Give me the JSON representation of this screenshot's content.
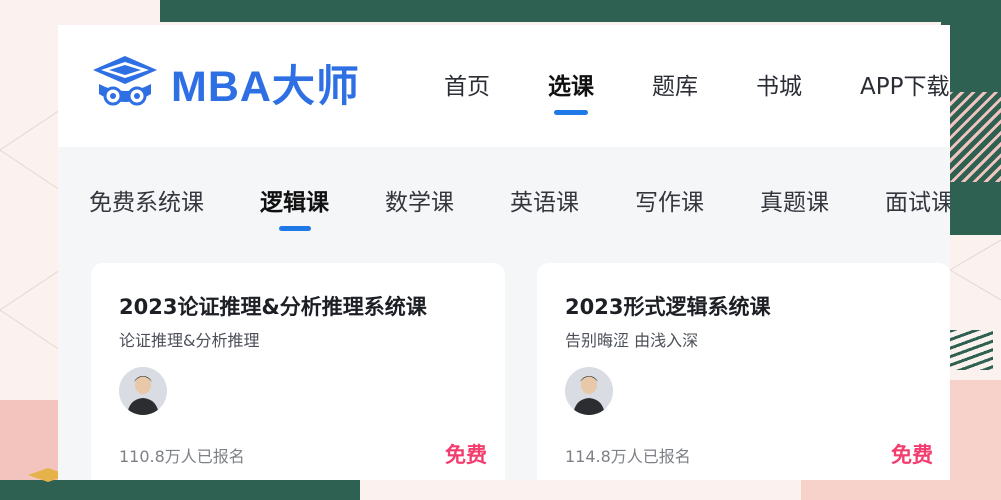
{
  "brand": {
    "name": "MBA大师",
    "accent": "#2f6fe4"
  },
  "nav": {
    "items": [
      "首页",
      "选课",
      "题库",
      "书城",
      "APP下载"
    ],
    "active_index": 1
  },
  "subnav": {
    "items": [
      "免费系统课",
      "逻辑课",
      "数学课",
      "英语课",
      "写作课",
      "真题课",
      "面试课"
    ],
    "active_index": 1
  },
  "courses": [
    {
      "title": "2023论证推理&分析推理系统课",
      "subtitle": "论证推理&分析推理",
      "enrolled": "110.8万人已报名",
      "price": "免费",
      "icon": "teacher-avatar"
    },
    {
      "title": "2023形式逻辑系统课",
      "subtitle": "告别晦涩 由浅入深",
      "enrolled": "114.8万人已报名",
      "price": "免费",
      "icon": "teacher-avatar"
    }
  ],
  "colors": {
    "tab_indicator": "#1f7ae8",
    "price": "#f23d6e",
    "bg_green": "#2f6152",
    "bg_pink": "#f3c4bd"
  }
}
